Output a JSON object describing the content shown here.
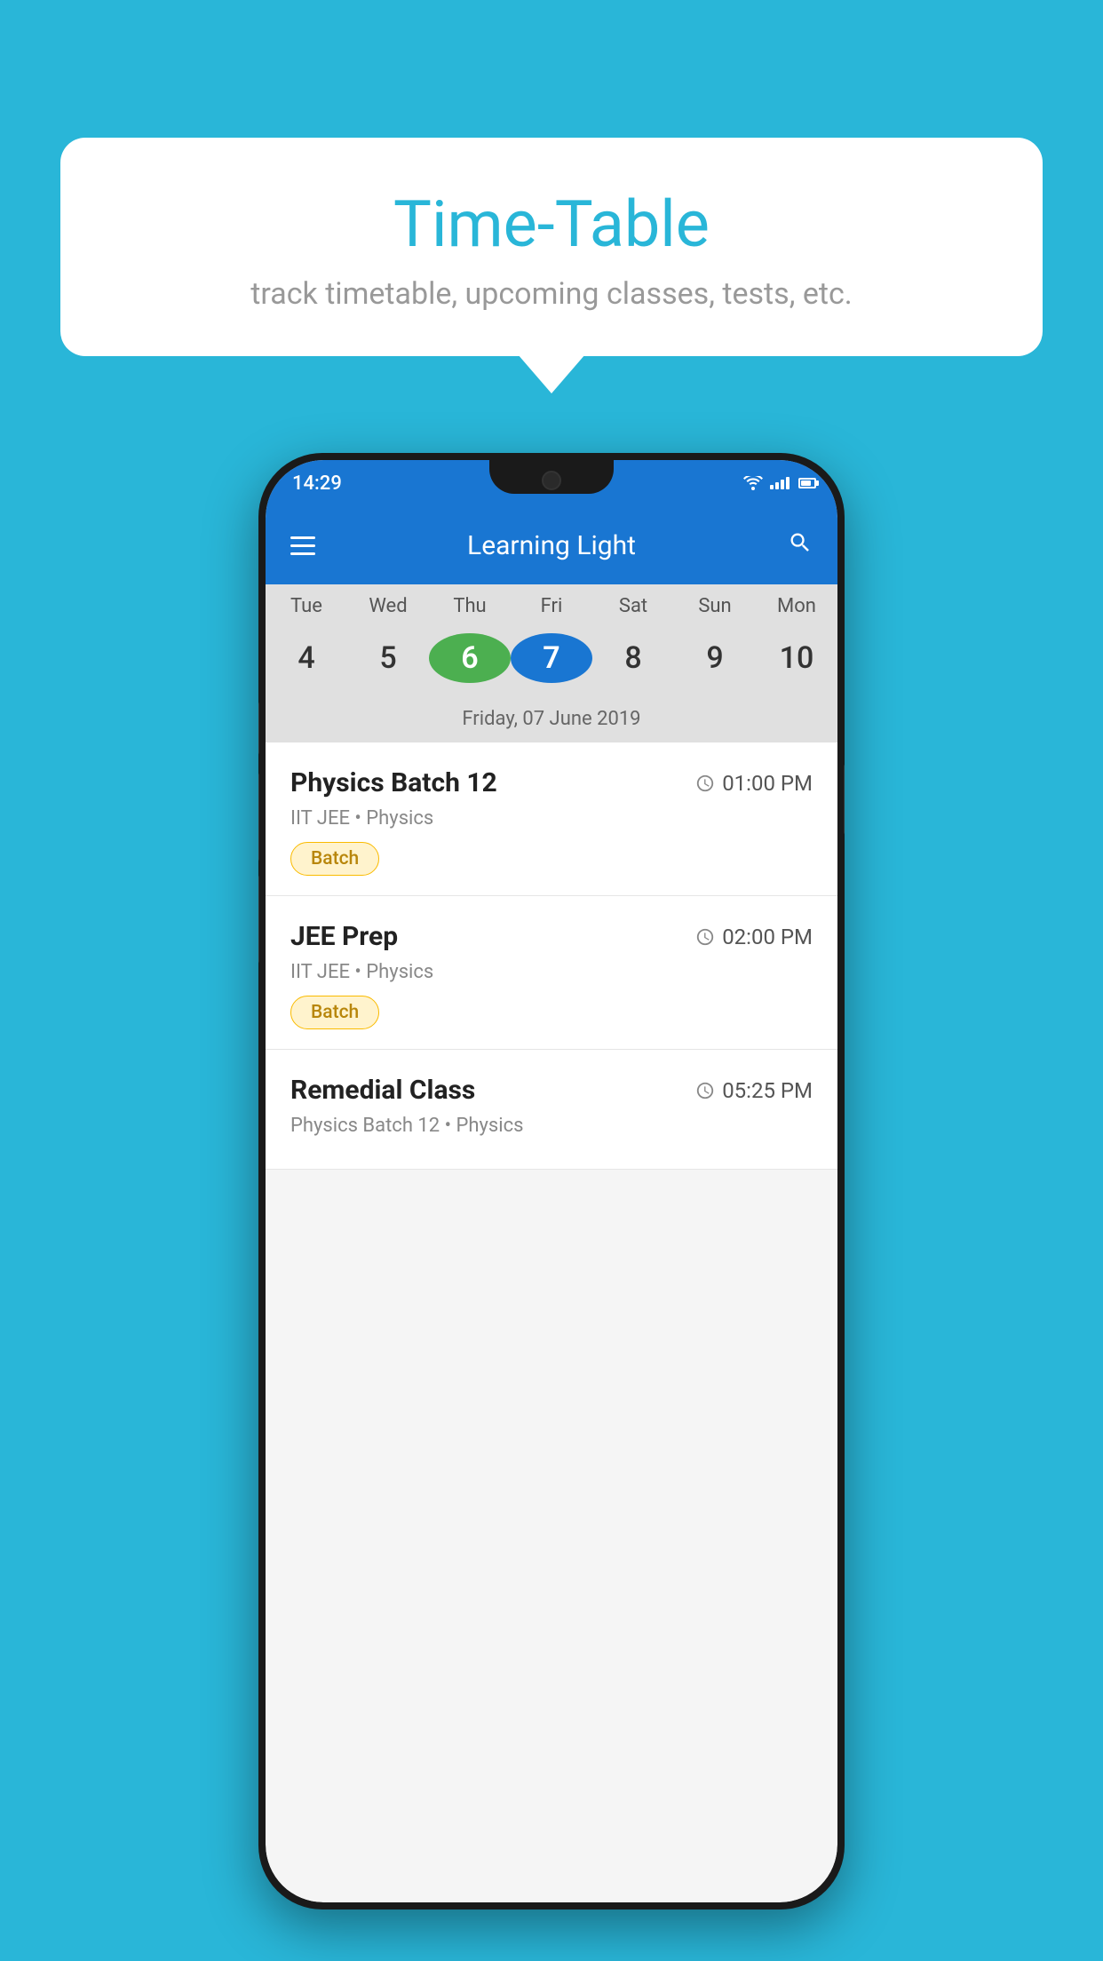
{
  "background_color": "#29B6D8",
  "tooltip": {
    "title": "Time-Table",
    "subtitle": "track timetable, upcoming classes, tests, etc."
  },
  "phone": {
    "status_bar": {
      "time": "14:29"
    },
    "app_bar": {
      "title": "Learning Light"
    },
    "calendar": {
      "days": [
        "Tue",
        "Wed",
        "Thu",
        "Fri",
        "Sat",
        "Sun",
        "Mon"
      ],
      "dates": [
        "4",
        "5",
        "6",
        "7",
        "8",
        "9",
        "10"
      ],
      "today_index": 2,
      "selected_index": 3,
      "selected_date_label": "Friday, 07 June 2019"
    },
    "schedule": [
      {
        "title": "Physics Batch 12",
        "time": "01:00 PM",
        "subtitle": "IIT JEE • Physics",
        "badge": "Batch"
      },
      {
        "title": "JEE Prep",
        "time": "02:00 PM",
        "subtitle": "IIT JEE • Physics",
        "badge": "Batch"
      },
      {
        "title": "Remedial Class",
        "time": "05:25 PM",
        "subtitle": "Physics Batch 12 • Physics",
        "badge": ""
      }
    ]
  }
}
